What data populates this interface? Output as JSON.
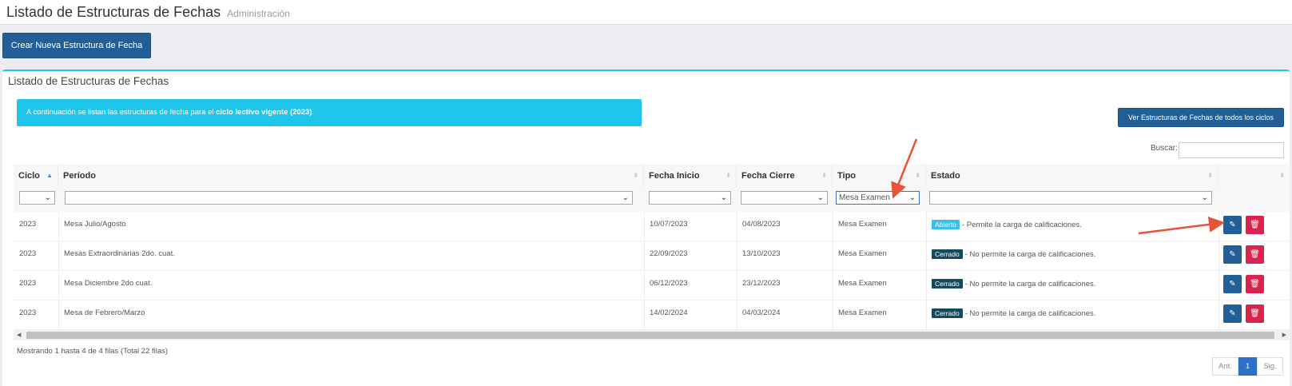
{
  "header": {
    "title": "Listado de Estructuras de Fechas",
    "subtitle": "Administración"
  },
  "toolbar": {
    "create_label": "Crear Nueva Estructura de Fecha"
  },
  "panel": {
    "title": "Listado de Estructuras de Fechas",
    "alert_prefix": "A continuación se listan las estructuras de fecha para el ",
    "alert_bold": "ciclo lectivo vigente (2023)",
    "alert_suffix": ".",
    "all_cycles_label": "Ver Estructuras de Fechas de todos los ciclos",
    "search_label": "Buscar:"
  },
  "table": {
    "columns": [
      "Ciclo",
      "Período",
      "Fecha Inicio",
      "Fecha Cierre",
      "Tipo",
      "Estado"
    ],
    "filters": {
      "ciclo": "",
      "periodo": "",
      "fecha_inicio": "",
      "fecha_cierre": "",
      "tipo": "Mesa Examen",
      "estado": ""
    },
    "rows": [
      {
        "ciclo": "2023",
        "periodo": "Mesa Julio/Agosto",
        "inicio": "10/07/2023",
        "cierre": "04/08/2023",
        "tipo": "Mesa Examen",
        "badge": "Abierto",
        "estado_text": "- Permite la carga de calificaciones."
      },
      {
        "ciclo": "2023",
        "periodo": "Mesas Extraordinarias 2do. cuat.",
        "inicio": "22/09/2023",
        "cierre": "13/10/2023",
        "tipo": "Mesa Examen",
        "badge": "Cerrado",
        "estado_text": "- No permite la carga de calificaciones."
      },
      {
        "ciclo": "2023",
        "periodo": "Mesa Diciembre 2do cuat.",
        "inicio": "06/12/2023",
        "cierre": "23/12/2023",
        "tipo": "Mesa Examen",
        "badge": "Cerrado",
        "estado_text": "- No permite la carga de calificaciones."
      },
      {
        "ciclo": "2023",
        "periodo": "Mesa de Febrero/Marzo",
        "inicio": "14/02/2024",
        "cierre": "04/03/2024",
        "tipo": "Mesa Examen",
        "badge": "Cerrado",
        "estado_text": "- No permite la carga de calificaciones."
      }
    ]
  },
  "footer": {
    "info": "Mostrando 1 hasta 4 de 4 filas (Total 22 filas)",
    "prev": "Ant.",
    "page": "1",
    "next": "Sig."
  },
  "colors": {
    "primary": "#235f97",
    "info": "#1fc6eb",
    "danger": "#d9234c",
    "badge_open": "#3bbfe6",
    "badge_closed": "#134a5d",
    "annotation_arrow": "#e8533a"
  }
}
